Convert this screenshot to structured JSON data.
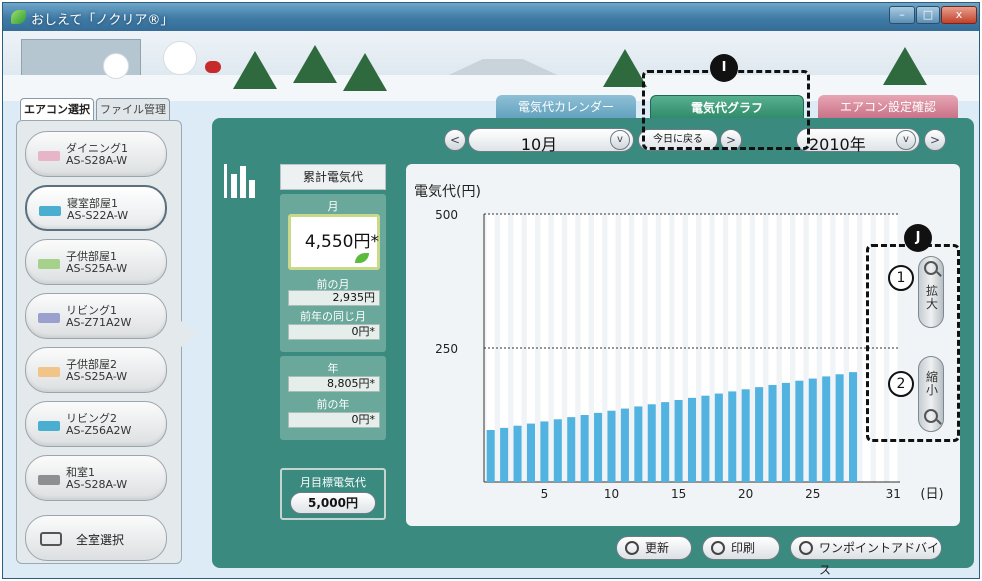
{
  "window": {
    "title": "おしえて「ノクリア®」",
    "min": "–",
    "max": "□",
    "close": "x"
  },
  "left_tabs": {
    "aircon": "エアコン選択",
    "files": "ファイル管理"
  },
  "rooms": [
    {
      "name": "ダイニング1",
      "model": "AS-S28A-W",
      "color": "#e6b6c8"
    },
    {
      "name": "寝室部屋1",
      "model": "AS-S22A-W",
      "color": "#4aaed0"
    },
    {
      "name": "子供部屋1",
      "model": "AS-S25A-W",
      "color": "#a6d18a"
    },
    {
      "name": "リビング1",
      "model": "AS-Z71A2W",
      "color": "#9aa1cf"
    },
    {
      "name": "子供部屋2",
      "model": "AS-S25A-W",
      "color": "#f1c58a"
    },
    {
      "name": "リビング2",
      "model": "AS-Z56A2W",
      "color": "#4aaed0"
    },
    {
      "name": "和室1",
      "model": "AS-S28A-W",
      "color": "#8d8f92"
    }
  ],
  "select_all": "全室選択",
  "tabs": {
    "calendar": "電気代カレンダー",
    "graph": "電気代グラフ",
    "aircon_check": "エアコン設定確認"
  },
  "nav": {
    "month": "10月",
    "today": "今日に戻る",
    "year": "2010年",
    "prev": "<",
    "next": ">",
    "drop": "v"
  },
  "summary": {
    "title": "累計電気代",
    "month_label": "月",
    "month_value": "4,550円*",
    "prev_month_label": "前の月",
    "prev_month_value": "2,935円",
    "last_year_same_month_label": "前年の同じ月",
    "last_year_same_month_value": "0円*",
    "year_label": "年",
    "year_value": "8,805円*",
    "prev_year_label": "前の年",
    "prev_year_value": "0円*",
    "target_label": "月目標電気代",
    "target_value": "5,000円"
  },
  "zoom": {
    "in": "拡大",
    "out": "縮小",
    "in_num": "1",
    "out_num": "2"
  },
  "callouts": {
    "i": "I",
    "j": "J"
  },
  "buttons": {
    "refresh": "更新",
    "print": "印刷",
    "advice": "ワンポイントアドバイス"
  },
  "chart_data": {
    "type": "bar",
    "ylabel": "電気代(円)",
    "xlabel": "(日)",
    "ylim": [
      0,
      500
    ],
    "yticks": [
      250,
      500
    ],
    "xticks": [
      5,
      10,
      15,
      20,
      25,
      31
    ],
    "days": 31,
    "x": [
      1,
      2,
      3,
      4,
      5,
      6,
      7,
      8,
      9,
      10,
      11,
      12,
      13,
      14,
      15,
      16,
      17,
      18,
      19,
      20,
      21,
      22,
      23,
      24,
      25,
      26,
      27,
      28
    ],
    "values": [
      97,
      101,
      105,
      109,
      113,
      117,
      121,
      125,
      129,
      133,
      137,
      141,
      145,
      149,
      153,
      157,
      161,
      165,
      169,
      173,
      177,
      181,
      185,
      189,
      193,
      197,
      201,
      205
    ],
    "bar_color": "#52b3e0",
    "stripe_color": "#ffffff"
  }
}
